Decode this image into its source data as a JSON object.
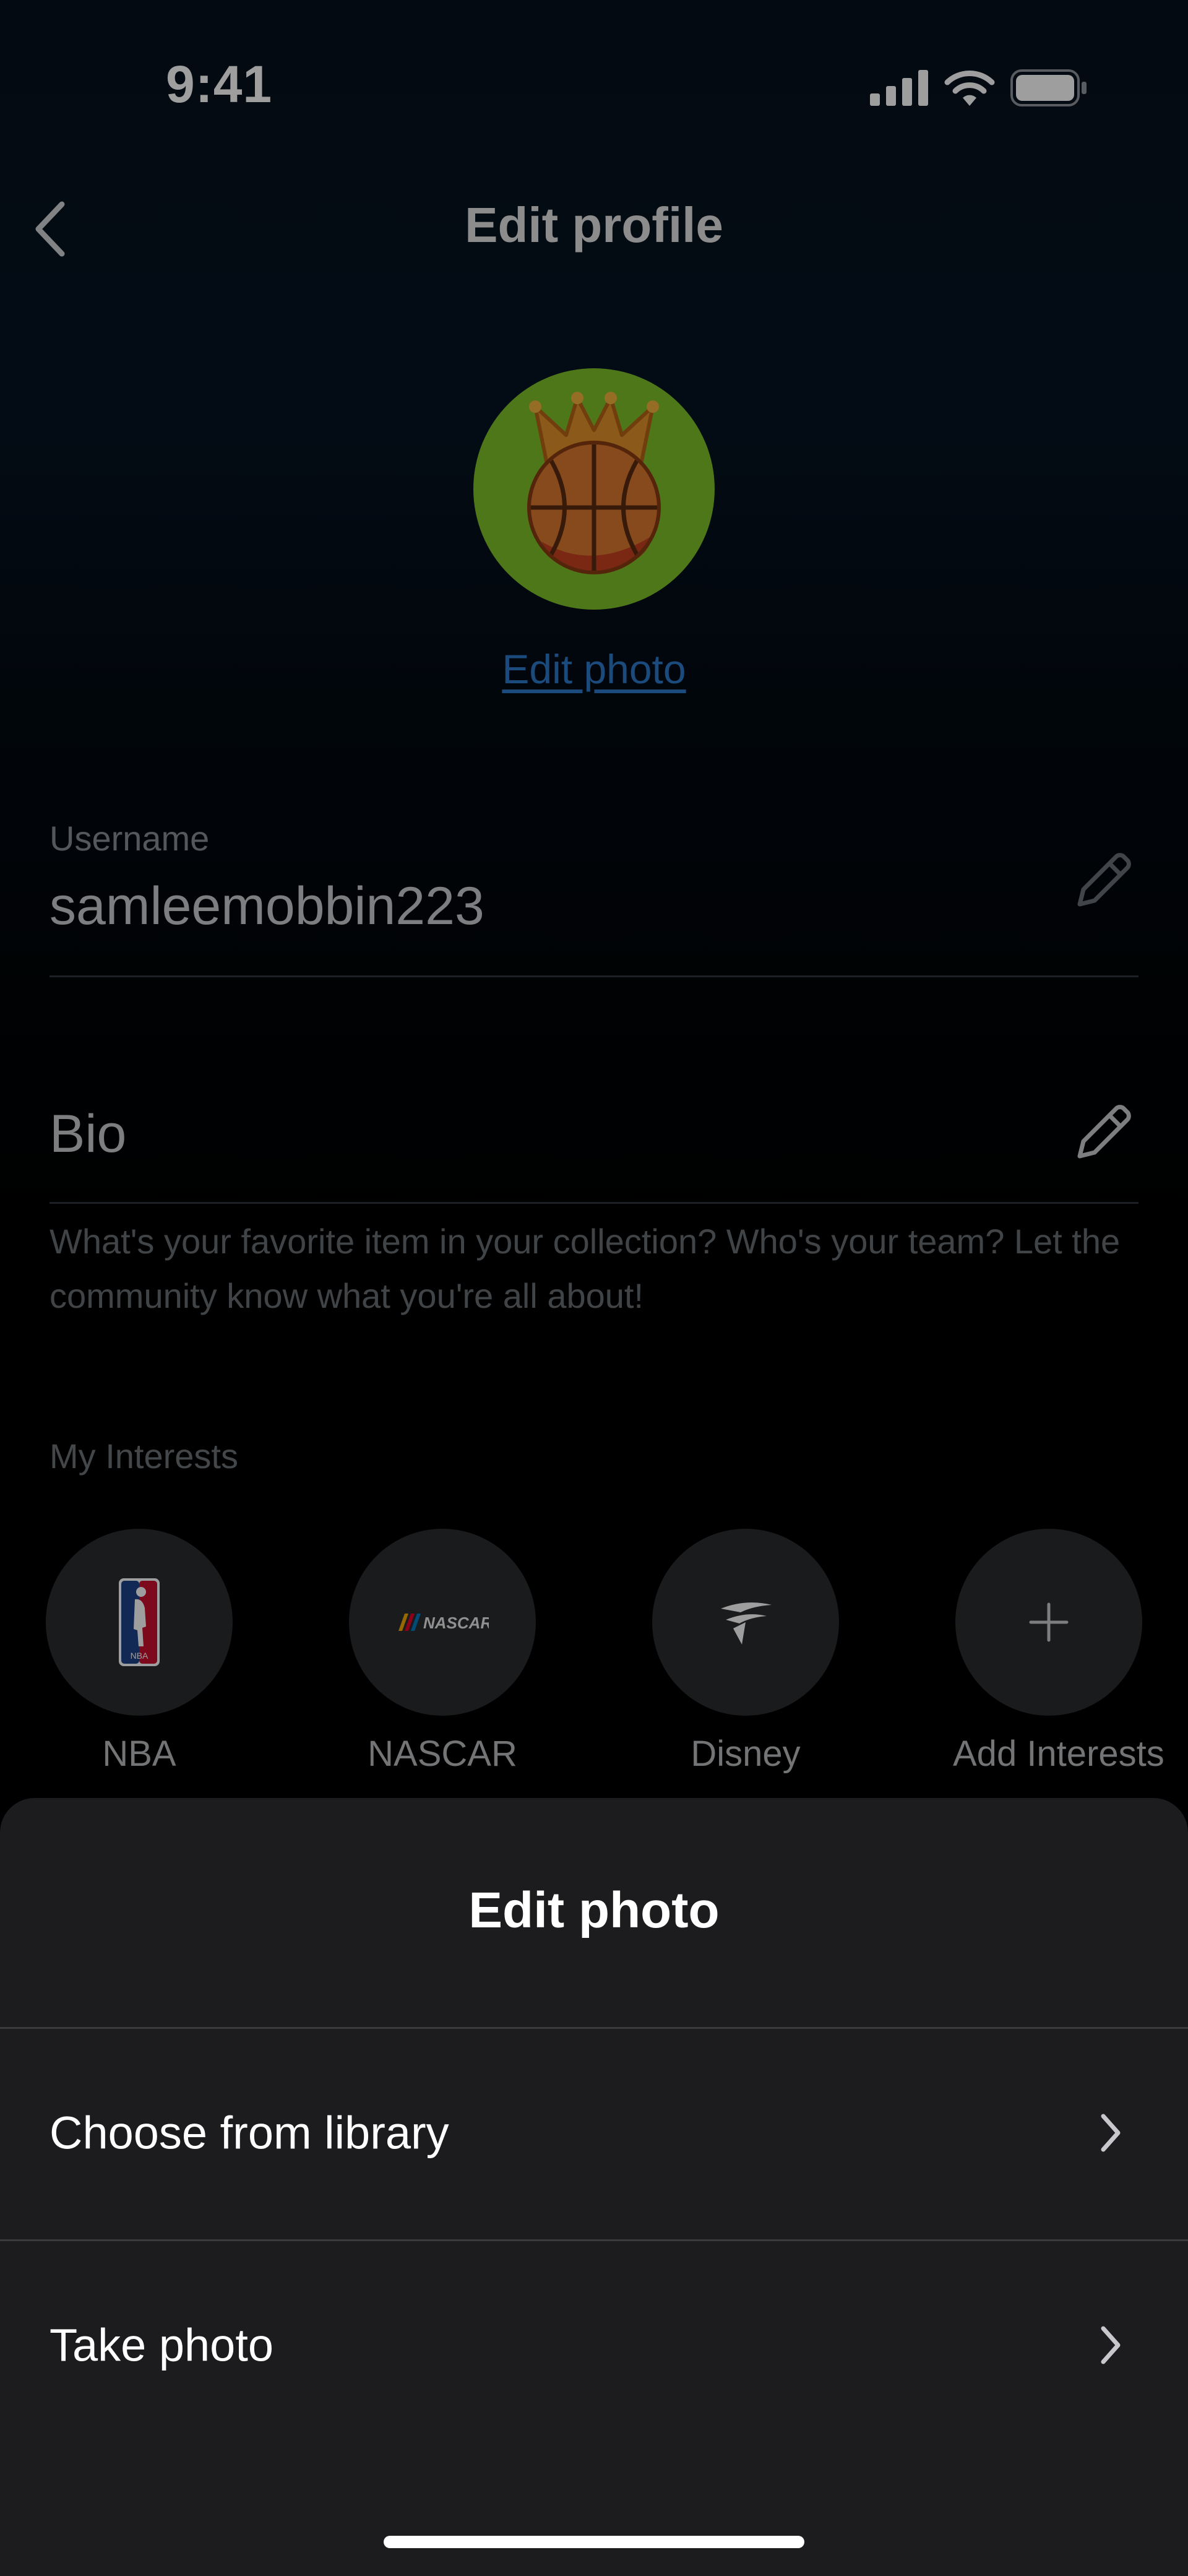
{
  "status_bar": {
    "time": "9:41"
  },
  "nav": {
    "title": "Edit profile",
    "back_icon": "chevron-left-icon"
  },
  "avatar": {
    "icon": "crowned-basketball-avatar",
    "background": "#7ec12b"
  },
  "edit_photo_link": "Edit photo",
  "username": {
    "label": "Username",
    "value": "samleemobbin223"
  },
  "bio": {
    "label": "Bio",
    "hint": "What's your favorite item in your collection? Who's your team? Let the community know what you're all about!"
  },
  "interests": {
    "title": "My Interests",
    "items": [
      {
        "name": "NBA",
        "icon": "nba-logo-icon"
      },
      {
        "name": "NASCAR",
        "icon": "nascar-logo-icon",
        "logo_text": "NASCAR"
      },
      {
        "name": "Disney",
        "icon": "disney-logo-icon"
      },
      {
        "name": "Add Interests",
        "icon": "plus-icon"
      }
    ]
  },
  "sheet": {
    "title": "Edit photo",
    "options": [
      {
        "label": "Choose from library"
      },
      {
        "label": "Take photo"
      }
    ]
  },
  "colors": {
    "link": "#2d78c8",
    "sheet_bg": "#1c1c1e",
    "avatar_bg": "#7ec12b"
  }
}
